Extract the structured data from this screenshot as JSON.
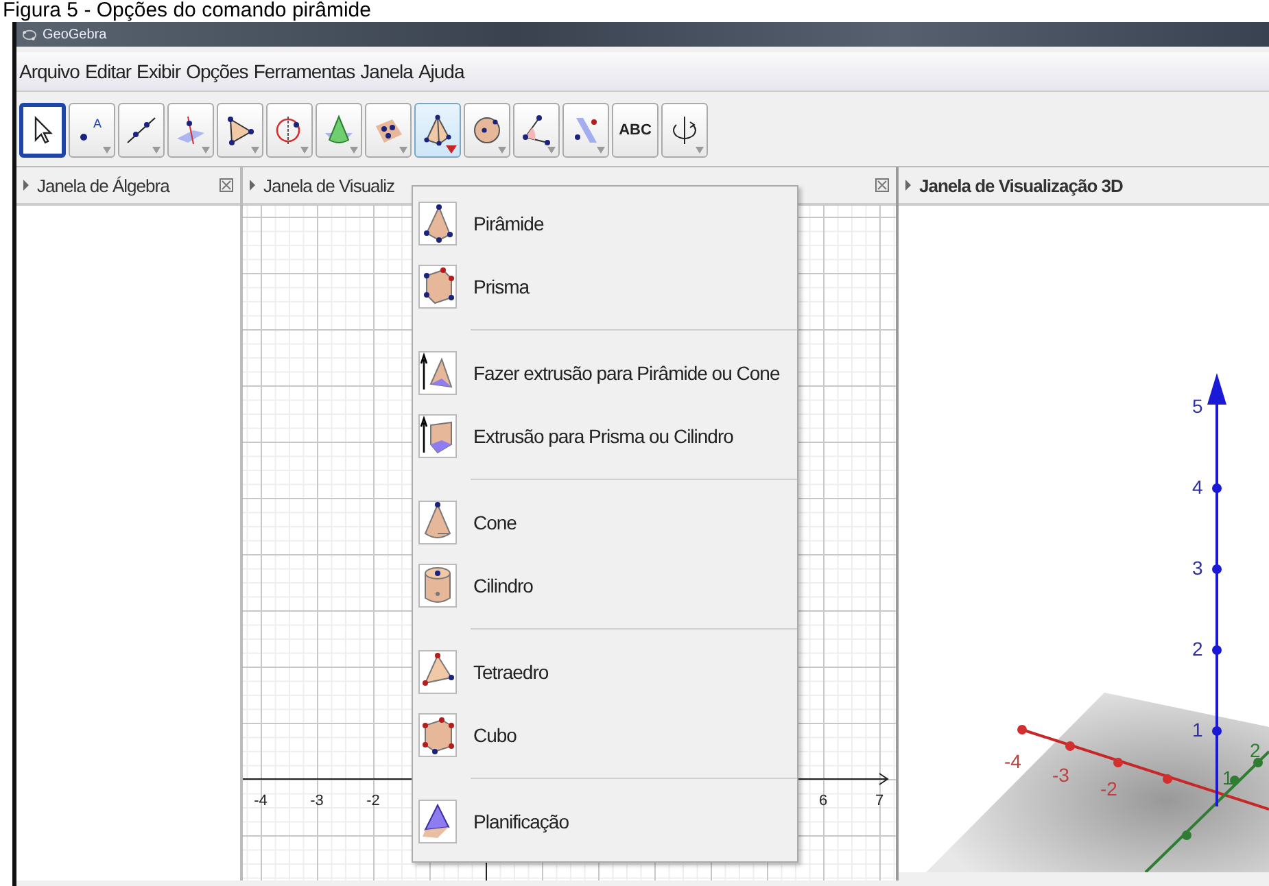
{
  "caption": "Figura 5 - Opções do comando pirâmide",
  "window": {
    "title": "GeoGebra"
  },
  "menu_bar": [
    "Arquivo",
    "Editar",
    "Exibir",
    "Opções",
    "Ferramentas",
    "Janela",
    "Ajuda"
  ],
  "tools": [
    {
      "kind": "select",
      "selected": true,
      "open": false,
      "has_menu": false
    },
    {
      "kind": "point",
      "label": "A",
      "selected": false,
      "open": false,
      "has_menu": true
    },
    {
      "kind": "line",
      "selected": false,
      "open": false,
      "has_menu": true
    },
    {
      "kind": "perpendicular",
      "selected": false,
      "open": false,
      "has_menu": true
    },
    {
      "kind": "polygon",
      "selected": false,
      "open": false,
      "has_menu": true
    },
    {
      "kind": "circle",
      "selected": false,
      "open": false,
      "has_menu": true
    },
    {
      "kind": "cone",
      "selected": false,
      "open": false,
      "has_menu": true
    },
    {
      "kind": "plane",
      "selected": false,
      "open": false,
      "has_menu": true
    },
    {
      "kind": "pyramid",
      "selected": false,
      "open": true,
      "has_menu": true
    },
    {
      "kind": "sphere",
      "selected": false,
      "open": false,
      "has_menu": true
    },
    {
      "kind": "angle",
      "selected": false,
      "open": false,
      "has_menu": true
    },
    {
      "kind": "reflect",
      "selected": false,
      "open": false,
      "has_menu": true
    },
    {
      "kind": "text",
      "label": "ABC",
      "selected": false,
      "open": false,
      "has_menu": false
    },
    {
      "kind": "rotate",
      "selected": false,
      "open": false,
      "has_menu": true
    }
  ],
  "algebra_panel": {
    "title": "Janela de Álgebra"
  },
  "graphics_panel": {
    "title": "Janela de Visualiz",
    "x_ticks": [
      "-4",
      "-3",
      "-2",
      "6",
      "7"
    ]
  },
  "view3d_panel": {
    "title": "Janela de Visualização 3D",
    "z_ticks": [
      "5",
      "4",
      "3",
      "2",
      "1"
    ],
    "x_ticks": [
      "-4",
      "-3",
      "-2"
    ],
    "y_ticks": [
      "1",
      "2"
    ]
  },
  "dropdown": {
    "groups": [
      [
        {
          "kind": "pyramid",
          "label": "Pirâmide"
        },
        {
          "kind": "prism",
          "label": "Prisma"
        }
      ],
      [
        {
          "kind": "extrude-pyramid",
          "label": "Fazer extrusão para Pirâmide ou Cone"
        },
        {
          "kind": "extrude-prism",
          "label": "Extrusão para Prisma ou Cilindro"
        }
      ],
      [
        {
          "kind": "cone",
          "label": "Cone"
        },
        {
          "kind": "cylinder",
          "label": "Cilindro"
        }
      ],
      [
        {
          "kind": "tetrahedron",
          "label": "Tetraedro"
        },
        {
          "kind": "cube",
          "label": "Cubo"
        }
      ],
      [
        {
          "kind": "net",
          "label": "Planificação"
        }
      ]
    ]
  }
}
